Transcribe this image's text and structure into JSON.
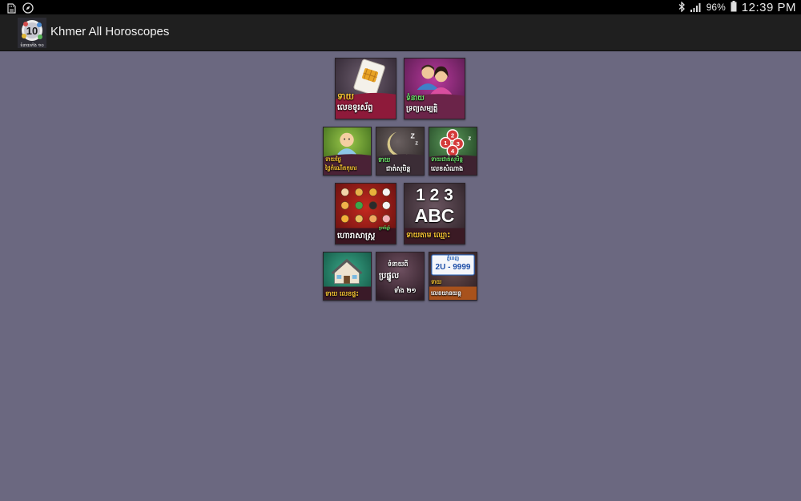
{
  "status_bar": {
    "battery_percent": "96%",
    "time": "12:39 PM",
    "icons": [
      "sd-card-icon",
      "compass-icon",
      "bluetooth-icon",
      "signal-icon",
      "battery-icon"
    ]
  },
  "action_bar": {
    "title": "Khmer All Horoscopes",
    "app_icon_badge": "10",
    "app_icon_caption": "ទំនាយទាំង ១០"
  },
  "tiles": [
    {
      "id": "phone-number",
      "line1": "ទាយ",
      "line2": "លេខទូរស័ព្ទ",
      "icon": "sim-card-icon"
    },
    {
      "id": "wealth",
      "line1": "ទំនាយ",
      "line2": "ទ្រព្យសម្បត្តិ",
      "icon": "couple-icon"
    },
    {
      "id": "birth-day",
      "line1": "ទាយថ្ងៃ",
      "line2": "ថ្ងៃកំណើតកុមារ",
      "icon": "baby-icon"
    },
    {
      "id": "dream",
      "line1": "ទាយ",
      "line2": "ជាត់សុបិន្ត",
      "icon": "moon-sleep-icon"
    },
    {
      "id": "dream-lottery",
      "line1": "ទាយជាត់សុបិន្ត",
      "line2": "លេខសំណាង",
      "icon": "lottery-balls-icon"
    },
    {
      "id": "zodiac",
      "line1": "ហោរាសាស្ត្រ",
      "line2": "ប្រចាំឆ្នាំ",
      "icon": "zodiac-animals-icon"
    },
    {
      "id": "name",
      "line1": "1 2 3",
      "line2": "ABC",
      "line3": "ទាយតាម ឈ្មោះ",
      "icon": "numbers-letters-icon"
    },
    {
      "id": "house-number",
      "line1": "ទាយ លេខផ្ទះ",
      "icon": "house-icon"
    },
    {
      "id": "daily-fortune",
      "line1": "ទំនាយពី",
      "line2": "ប្រផ្នូល",
      "line3": "ទាំង ២១",
      "icon": "fortune-icon"
    },
    {
      "id": "plate-number",
      "line1": "ភ្នំពេញ",
      "line2": "2U - 9999",
      "line3": "ទាយ",
      "line4": "លេខយានយន្ត",
      "icon": "license-plate-icon"
    }
  ],
  "colors": {
    "background": "#6b6880",
    "action_bar": "#1f1f1f",
    "status_bar": "#000000",
    "caption_gold": "#f3c133",
    "caption_green": "#6ae36a"
  }
}
